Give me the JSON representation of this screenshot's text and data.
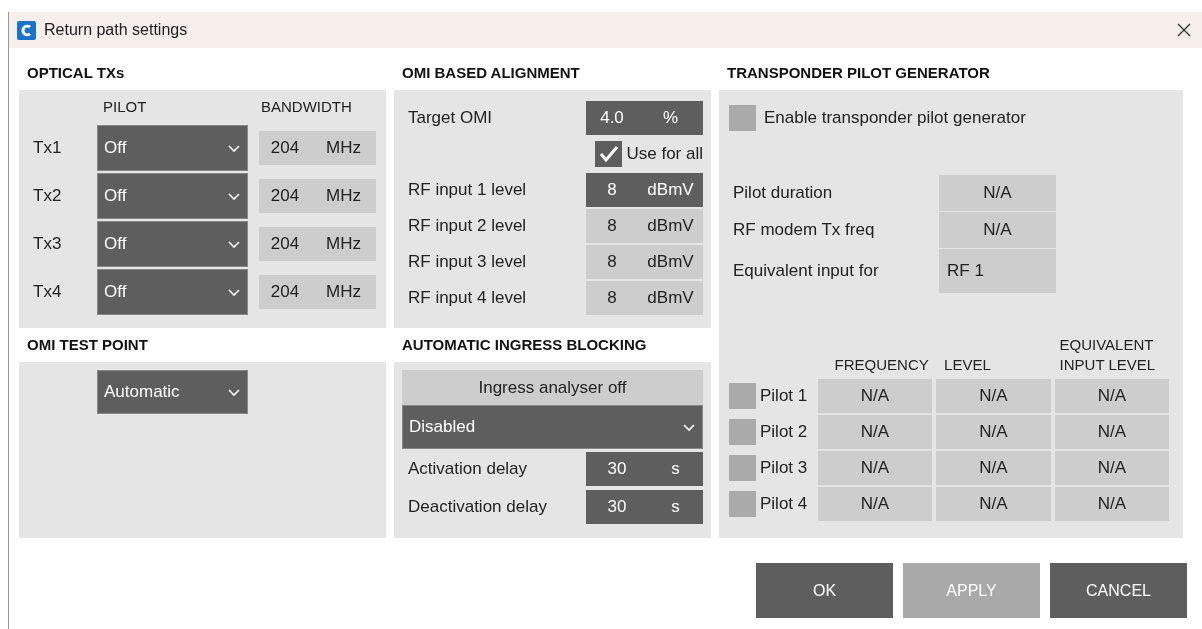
{
  "window": {
    "title": "Return path settings"
  },
  "optical_txs": {
    "heading": "OPTICAL TXs",
    "columns": [
      "PILOT",
      "BANDWIDTH"
    ],
    "rows": [
      {
        "label": "Tx1",
        "pilot": "Off",
        "bandwidth": "204",
        "unit": "MHz"
      },
      {
        "label": "Tx2",
        "pilot": "Off",
        "bandwidth": "204",
        "unit": "MHz"
      },
      {
        "label": "Tx3",
        "pilot": "Off",
        "bandwidth": "204",
        "unit": "MHz"
      },
      {
        "label": "Tx4",
        "pilot": "Off",
        "bandwidth": "204",
        "unit": "MHz"
      }
    ]
  },
  "omi_alignment": {
    "heading": "OMI BASED ALIGNMENT",
    "target": {
      "label": "Target OMI",
      "value": "4.0",
      "unit": "%",
      "enabled": true
    },
    "use_for_all": {
      "label": "Use for all",
      "checked": true
    },
    "inputs": [
      {
        "label": "RF input 1 level",
        "value": "8",
        "unit": "dBmV",
        "enabled": true
      },
      {
        "label": "RF input 2 level",
        "value": "8",
        "unit": "dBmV",
        "enabled": false
      },
      {
        "label": "RF input 3 level",
        "value": "8",
        "unit": "dBmV",
        "enabled": false
      },
      {
        "label": "RF input 4 level",
        "value": "8",
        "unit": "dBmV",
        "enabled": false
      }
    ]
  },
  "transponder": {
    "heading": "TRANSPONDER PILOT GENERATOR",
    "enable": {
      "label": "Enable transponder pilot generator",
      "checked": false
    },
    "fields": [
      {
        "label": "Pilot duration",
        "value": "N/A",
        "kind": "readout"
      },
      {
        "label": "RF modem Tx freq",
        "value": "N/A",
        "kind": "readout"
      },
      {
        "label": "Equivalent input for",
        "value": "RF 1",
        "kind": "choice"
      }
    ],
    "table": {
      "columns": [
        "FREQUENCY",
        "LEVEL",
        "EQUIVALENT INPUT LEVEL"
      ],
      "rows": [
        {
          "label": "Pilot 1",
          "checked": false,
          "cells": [
            "N/A",
            "N/A",
            "N/A"
          ]
        },
        {
          "label": "Pilot 2",
          "checked": false,
          "cells": [
            "N/A",
            "N/A",
            "N/A"
          ]
        },
        {
          "label": "Pilot 3",
          "checked": false,
          "cells": [
            "N/A",
            "N/A",
            "N/A"
          ]
        },
        {
          "label": "Pilot 4",
          "checked": false,
          "cells": [
            "N/A",
            "N/A",
            "N/A"
          ]
        }
      ]
    }
  },
  "omi_test_point": {
    "heading": "OMI TEST POINT",
    "value": "Automatic"
  },
  "ingress": {
    "heading": "AUTOMATIC INGRESS BLOCKING",
    "status": "Ingress analyser off",
    "mode": "Disabled",
    "delays": [
      {
        "label": "Activation delay",
        "value": "30",
        "unit": "s",
        "enabled": true
      },
      {
        "label": "Deactivation delay",
        "value": "30",
        "unit": "s",
        "enabled": true
      }
    ]
  },
  "buttons": [
    {
      "label": "OK",
      "disabled": false
    },
    {
      "label": "APPLY",
      "disabled": true
    },
    {
      "label": "CANCEL",
      "disabled": false
    }
  ]
}
